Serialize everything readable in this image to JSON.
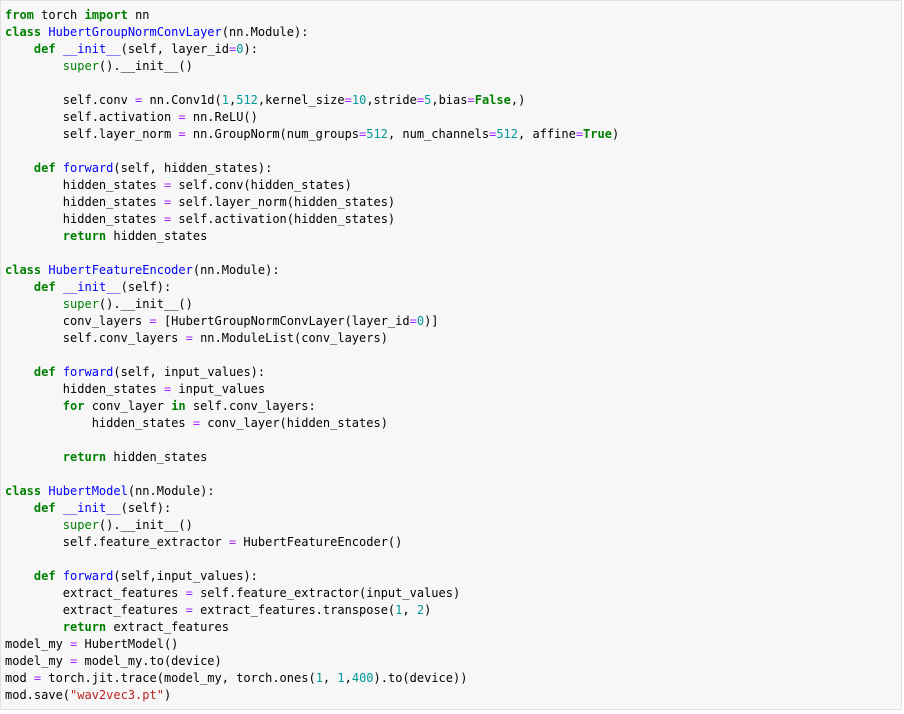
{
  "editor": {
    "language": "python",
    "colors": {
      "background": "#f7f7f7",
      "border": "#e1e1e1",
      "keyword": "#008000",
      "definition_name": "#0000ff",
      "number": "#009999",
      "operator": "#aa22ff",
      "string": "#ba2121",
      "text": "#000000"
    },
    "lines": [
      [
        {
          "t": "from",
          "c": "kw"
        },
        {
          "t": " torch "
        },
        {
          "t": "import",
          "c": "kw"
        },
        {
          "t": " nn"
        }
      ],
      [
        {
          "t": "class",
          "c": "kw"
        },
        {
          "t": " "
        },
        {
          "t": "HubertGroupNormConvLayer",
          "c": "nm"
        },
        {
          "t": "(nn.Module):"
        }
      ],
      [
        {
          "t": "    "
        },
        {
          "t": "def",
          "c": "kw"
        },
        {
          "t": " "
        },
        {
          "t": "__init__",
          "c": "nm"
        },
        {
          "t": "(self, layer_id"
        },
        {
          "t": "=",
          "c": "op"
        },
        {
          "t": "0",
          "c": "num"
        },
        {
          "t": "):"
        }
      ],
      [
        {
          "t": "        "
        },
        {
          "t": "super",
          "c": "bi"
        },
        {
          "t": "().__init__()"
        }
      ],
      [],
      [
        {
          "t": "        self.conv "
        },
        {
          "t": "=",
          "c": "op"
        },
        {
          "t": " nn.Conv1d("
        },
        {
          "t": "1",
          "c": "num"
        },
        {
          "t": ","
        },
        {
          "t": "512",
          "c": "num"
        },
        {
          "t": ",kernel_size"
        },
        {
          "t": "=",
          "c": "op"
        },
        {
          "t": "10",
          "c": "num"
        },
        {
          "t": ",stride"
        },
        {
          "t": "=",
          "c": "op"
        },
        {
          "t": "5",
          "c": "num"
        },
        {
          "t": ",bias"
        },
        {
          "t": "=",
          "c": "op"
        },
        {
          "t": "False",
          "c": "kw"
        },
        {
          "t": ",)"
        }
      ],
      [
        {
          "t": "        self.activation "
        },
        {
          "t": "=",
          "c": "op"
        },
        {
          "t": " nn.ReLU()"
        }
      ],
      [
        {
          "t": "        self.layer_norm "
        },
        {
          "t": "=",
          "c": "op"
        },
        {
          "t": " nn.GroupNorm(num_groups"
        },
        {
          "t": "=",
          "c": "op"
        },
        {
          "t": "512",
          "c": "num"
        },
        {
          "t": ", num_channels"
        },
        {
          "t": "=",
          "c": "op"
        },
        {
          "t": "512",
          "c": "num"
        },
        {
          "t": ", affine"
        },
        {
          "t": "=",
          "c": "op"
        },
        {
          "t": "True",
          "c": "kw"
        },
        {
          "t": ")"
        }
      ],
      [],
      [
        {
          "t": "    "
        },
        {
          "t": "def",
          "c": "kw"
        },
        {
          "t": " "
        },
        {
          "t": "forward",
          "c": "nm"
        },
        {
          "t": "(self, hidden_states):"
        }
      ],
      [
        {
          "t": "        hidden_states "
        },
        {
          "t": "=",
          "c": "op"
        },
        {
          "t": " self.conv(hidden_states)"
        }
      ],
      [
        {
          "t": "        hidden_states "
        },
        {
          "t": "=",
          "c": "op"
        },
        {
          "t": " self.layer_norm(hidden_states)"
        }
      ],
      [
        {
          "t": "        hidden_states "
        },
        {
          "t": "=",
          "c": "op"
        },
        {
          "t": " self.activation(hidden_states)"
        }
      ],
      [
        {
          "t": "        "
        },
        {
          "t": "return",
          "c": "kw"
        },
        {
          "t": " hidden_states"
        }
      ],
      [],
      [
        {
          "t": "class",
          "c": "kw"
        },
        {
          "t": " "
        },
        {
          "t": "HubertFeatureEncoder",
          "c": "nm"
        },
        {
          "t": "(nn.Module):"
        }
      ],
      [
        {
          "t": "    "
        },
        {
          "t": "def",
          "c": "kw"
        },
        {
          "t": " "
        },
        {
          "t": "__init__",
          "c": "nm"
        },
        {
          "t": "(self):"
        }
      ],
      [
        {
          "t": "        "
        },
        {
          "t": "super",
          "c": "bi"
        },
        {
          "t": "().__init__()"
        }
      ],
      [
        {
          "t": "        conv_layers "
        },
        {
          "t": "=",
          "c": "op"
        },
        {
          "t": " [HubertGroupNormConvLayer(layer_id"
        },
        {
          "t": "=",
          "c": "op"
        },
        {
          "t": "0",
          "c": "num"
        },
        {
          "t": ")]"
        }
      ],
      [
        {
          "t": "        self.conv_layers "
        },
        {
          "t": "=",
          "c": "op"
        },
        {
          "t": " nn.ModuleList(conv_layers)"
        }
      ],
      [],
      [
        {
          "t": "    "
        },
        {
          "t": "def",
          "c": "kw"
        },
        {
          "t": " "
        },
        {
          "t": "forward",
          "c": "nm"
        },
        {
          "t": "(self, input_values):"
        }
      ],
      [
        {
          "t": "        hidden_states "
        },
        {
          "t": "=",
          "c": "op"
        },
        {
          "t": " input_values"
        }
      ],
      [
        {
          "t": "        "
        },
        {
          "t": "for",
          "c": "kw"
        },
        {
          "t": " conv_layer "
        },
        {
          "t": "in",
          "c": "kw"
        },
        {
          "t": " self.conv_layers:"
        }
      ],
      [
        {
          "t": "            hidden_states "
        },
        {
          "t": "=",
          "c": "op"
        },
        {
          "t": " conv_layer(hidden_states)"
        }
      ],
      [],
      [
        {
          "t": "        "
        },
        {
          "t": "return",
          "c": "kw"
        },
        {
          "t": " hidden_states"
        }
      ],
      [],
      [
        {
          "t": "class",
          "c": "kw"
        },
        {
          "t": " "
        },
        {
          "t": "HubertModel",
          "c": "nm"
        },
        {
          "t": "(nn.Module):"
        }
      ],
      [
        {
          "t": "    "
        },
        {
          "t": "def",
          "c": "kw"
        },
        {
          "t": " "
        },
        {
          "t": "__init__",
          "c": "nm"
        },
        {
          "t": "(self):"
        }
      ],
      [
        {
          "t": "        "
        },
        {
          "t": "super",
          "c": "bi"
        },
        {
          "t": "().__init__()"
        }
      ],
      [
        {
          "t": "        self.feature_extractor "
        },
        {
          "t": "=",
          "c": "op"
        },
        {
          "t": " HubertFeatureEncoder()"
        }
      ],
      [],
      [
        {
          "t": "    "
        },
        {
          "t": "def",
          "c": "kw"
        },
        {
          "t": " "
        },
        {
          "t": "forward",
          "c": "nm"
        },
        {
          "t": "(self,input_values):"
        }
      ],
      [
        {
          "t": "        extract_features "
        },
        {
          "t": "=",
          "c": "op"
        },
        {
          "t": " self.feature_extractor(input_values)"
        }
      ],
      [
        {
          "t": "        extract_features "
        },
        {
          "t": "=",
          "c": "op"
        },
        {
          "t": " extract_features.transpose("
        },
        {
          "t": "1",
          "c": "num"
        },
        {
          "t": ", "
        },
        {
          "t": "2",
          "c": "num"
        },
        {
          "t": ")"
        }
      ],
      [
        {
          "t": "        "
        },
        {
          "t": "return",
          "c": "kw"
        },
        {
          "t": " extract_features"
        }
      ],
      [
        {
          "t": "model_my "
        },
        {
          "t": "=",
          "c": "op"
        },
        {
          "t": " HubertModel()"
        }
      ],
      [
        {
          "t": "model_my "
        },
        {
          "t": "=",
          "c": "op"
        },
        {
          "t": " model_my.to(device)"
        }
      ],
      [
        {
          "t": "mod "
        },
        {
          "t": "=",
          "c": "op"
        },
        {
          "t": " torch.jit.trace(model_my, torch.ones("
        },
        {
          "t": "1",
          "c": "num"
        },
        {
          "t": ", "
        },
        {
          "t": "1",
          "c": "num"
        },
        {
          "t": ","
        },
        {
          "t": "400",
          "c": "num"
        },
        {
          "t": ").to(device))"
        }
      ],
      [
        {
          "t": "mod.save("
        },
        {
          "t": "\"wav2vec3.pt\"",
          "c": "str"
        },
        {
          "t": ")"
        }
      ]
    ]
  }
}
